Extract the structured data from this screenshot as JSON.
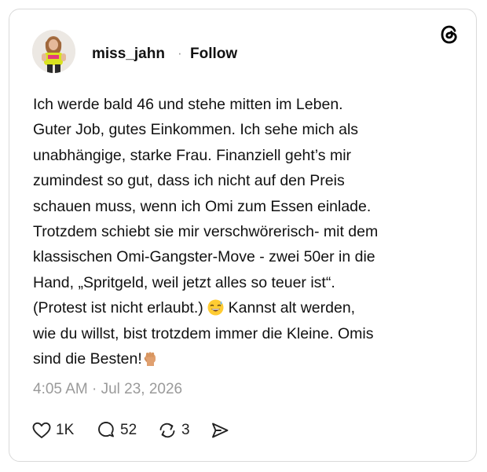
{
  "post": {
    "username": "miss_jahn",
    "separator": "·",
    "follow_label": "Follow",
    "text_lines": [
      "Ich werde bald 46 und stehe mitten im Leben.",
      "Guter Job, gutes Einkommen. Ich sehe mich als",
      "unabhängige, starke Frau. Finanziell geht’s mir",
      "zumindest so gut, dass ich nicht auf den Preis",
      "schauen muss, wenn ich Omi zum Essen einlade.",
      "Trotzdem schiebt sie mir verschwörerisch- mit dem",
      "klassischen Omi-Gangster-Move - zwei 50er in die",
      "Hand, „Spritgeld, weil jetzt alles so teuer ist“.",
      "(Protest ist nicht erlaubt.) ",
      " Kannst alt werden,",
      "wie du willst, bist trotzdem immer die Kleine. Omis",
      "sind die Besten!"
    ],
    "timestamp": "4:05 AM · Jul 23, 2026",
    "likes": "1K",
    "replies": "52",
    "reposts": "3"
  },
  "icons": {
    "brand": "threads-logo-icon",
    "like": "heart-icon",
    "reply": "comment-icon",
    "repost": "repost-icon",
    "share": "share-icon",
    "emoji1": "sweat-smile-emoji",
    "emoji2": "raised-fist-emoji"
  },
  "colors": {
    "text": "#111111",
    "muted": "#9a9a9a",
    "border": "#d9d9d9"
  }
}
